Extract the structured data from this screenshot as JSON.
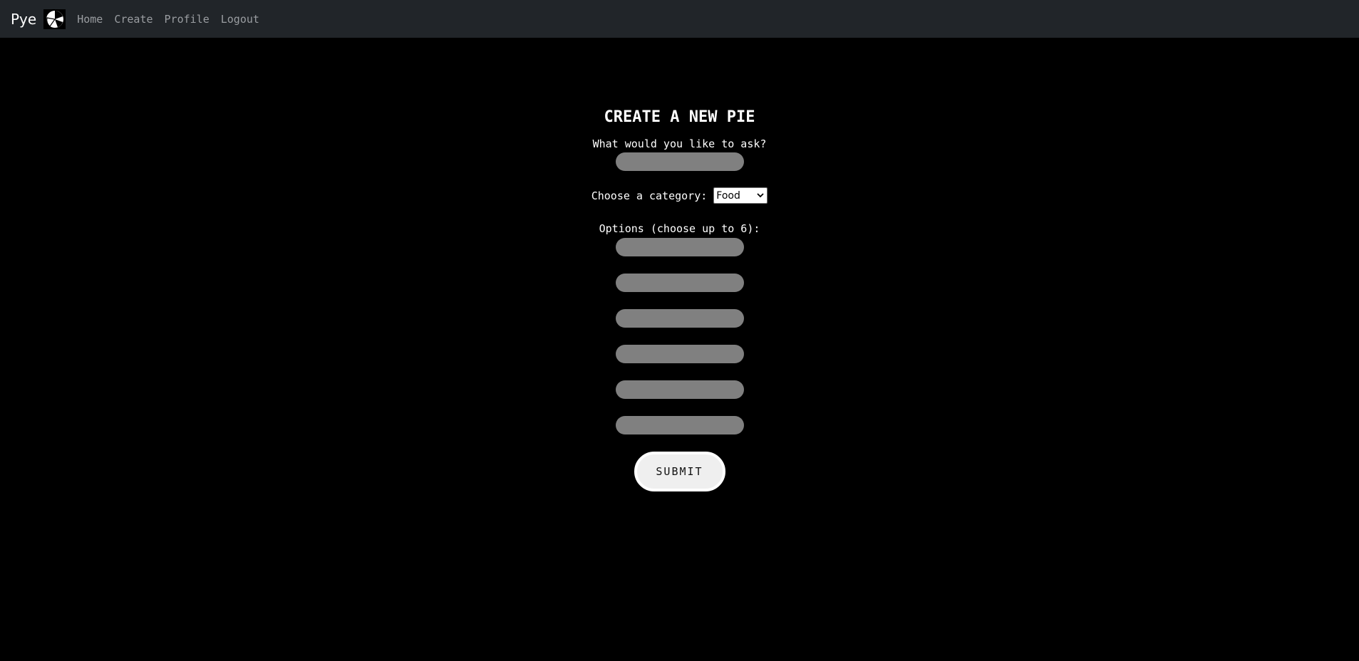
{
  "navbar": {
    "brand": "Pye",
    "links": [
      {
        "label": "Home"
      },
      {
        "label": "Create"
      },
      {
        "label": "Profile"
      },
      {
        "label": "Logout"
      }
    ],
    "bg_color": "#212529",
    "link_color": "#9a9da1"
  },
  "form": {
    "title": "CREATE A NEW PIE",
    "question_label": "What would you like to ask?",
    "question_value": "",
    "category_label": "Choose a category:",
    "category_selected": "Food",
    "options_label": "Options (choose up to 6):",
    "option_values": [
      "",
      "",
      "",
      "",
      "",
      ""
    ],
    "submit_label": "SUBMIT",
    "input_color": "#808080"
  }
}
